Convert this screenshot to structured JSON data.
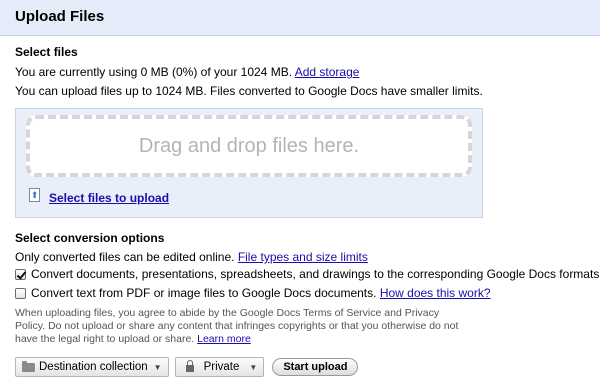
{
  "dialog": {
    "title": "Upload Files"
  },
  "select_files": {
    "heading": "Select files",
    "usage_prefix": "You are currently using 0 MB (0%) of your 1024 MB.",
    "add_storage_link": "Add storage",
    "limit_text": "You can upload files up to 1024 MB. Files converted to Google Docs have smaller limits.",
    "drop_zone_text": "Drag and drop files here.",
    "select_link": "Select files to upload"
  },
  "conversion": {
    "heading": "Select conversion options",
    "info_prefix": "Only converted files can be edited online.",
    "file_types_link": "File types and size limits",
    "options": [
      {
        "label": "Convert documents, presentations, spreadsheets, and drawings to the corresponding Google Docs formats",
        "checked": true
      },
      {
        "label": "Convert text from PDF or image files to Google Docs documents.",
        "link": "How does this work?",
        "checked": false
      }
    ]
  },
  "disclaimer": {
    "text": "When uploading files, you agree to abide by the Google Docs Terms of Service and Privacy Policy. Do not upload or share any content that infringes copyrights or that you otherwise do not have the legal right to upload or share.",
    "link": "Learn more"
  },
  "toolbar": {
    "destination_label": "Destination collection",
    "privacy_label": "Private",
    "start_label": "Start upload"
  }
}
